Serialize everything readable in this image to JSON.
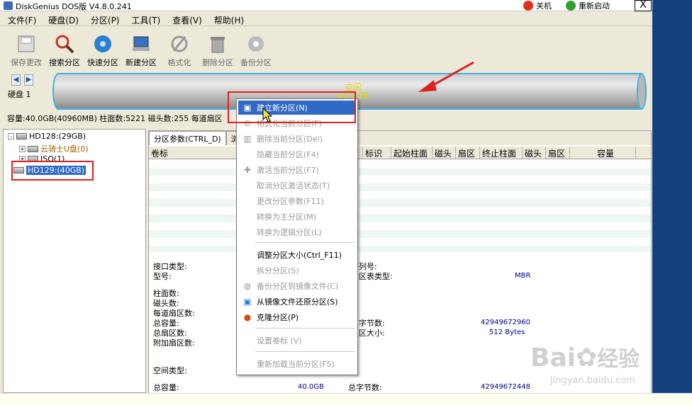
{
  "window": {
    "title": "DiskGenius DOS版 V4.8.0.241",
    "shutdown": "关机",
    "restart": "重新启动",
    "close": "X"
  },
  "menu": [
    "文件(F)",
    "硬盘(D)",
    "分区(P)",
    "工具(T)",
    "查看(V)",
    "帮助(H)"
  ],
  "toolbar": [
    {
      "label": "保存更改",
      "icon": "save-icon",
      "enabled": false
    },
    {
      "label": "搜索分区",
      "icon": "search-icon",
      "enabled": true
    },
    {
      "label": "快速分区",
      "icon": "quick-partition-icon",
      "enabled": true
    },
    {
      "label": "新建分区",
      "icon": "new-partition-icon",
      "enabled": true
    },
    {
      "label": "格式化",
      "icon": "format-icon",
      "enabled": false
    },
    {
      "label": "删除分区",
      "icon": "trash-icon",
      "enabled": false
    },
    {
      "label": "备份分区",
      "icon": "backup-icon",
      "enabled": false
    }
  ],
  "diskbar": {
    "disk_label": "硬盘 1",
    "free_label": "空闲",
    "free_size": "40.0GB",
    "info": "容量:40.0GB(40960MB)  柱面数:5221  磁头数:255  每道扇区"
  },
  "tree": [
    {
      "label": "HD128:(29GB)",
      "level": 0,
      "expander": "-"
    },
    {
      "label": "云骑士U盘(0)",
      "level": 1,
      "expander": "+",
      "color": "#a06000"
    },
    {
      "label": "ISO(1)",
      "level": 1,
      "expander": "+"
    },
    {
      "label": "HD129:(40GB)",
      "level": 0,
      "expander": "",
      "selected": true
    }
  ],
  "tabs": [
    "分区参数(CTRL_D)",
    "浏"
  ],
  "columns": [
    "卷标",
    "标识",
    "起始柱面",
    "磁头",
    "扇区",
    "终止柱面",
    "磁头",
    "扇区",
    "容量"
  ],
  "details": {
    "iface_type": "接口类型:",
    "model": "型号:",
    "serial": "列号:",
    "part_table_type": "区表类型:",
    "part_table_value": "MBR",
    "cylinders": "柱面数:",
    "heads": "磁头数:",
    "sectors_per_track": "每道扇区数:",
    "total_capacity": "总容量:",
    "total_sectors": "总扇区数:",
    "extra_sectors": "附加扇区数:",
    "total_bytes": "字节数:",
    "total_bytes_value": "42949672960",
    "sector_size": "区大小:",
    "sector_size_value": "512 Bytes",
    "space_type": "空间类型:",
    "b_total_capacity": "总容量:",
    "b_capacity_value": "40.0GB",
    "b_total_bytes": "总字节数:",
    "b_total_bytes_value": "42949672448"
  },
  "context_menu": [
    {
      "label": "建立新分区(N)",
      "enabled": true,
      "selected": true,
      "icon": "new-partition-icon"
    },
    {
      "label": "格式化当前分区(F)",
      "enabled": false,
      "icon": "format-icon"
    },
    {
      "label": "删除当前分区(Del)",
      "enabled": false,
      "icon": "trash-icon"
    },
    {
      "label": "隐藏当前分区(F4)",
      "enabled": false
    },
    {
      "label": "激活当前分区(F7)",
      "enabled": false,
      "icon": "activate-icon"
    },
    {
      "label": "取消分区激活状态(T)",
      "enabled": false
    },
    {
      "label": "更改分区参数(F11)",
      "enabled": false
    },
    {
      "label": "转换为主分区(M)",
      "enabled": false
    },
    {
      "label": "转换为逻辑分区(L)",
      "enabled": false
    },
    {
      "label": "调整分区大小(Ctrl_F11)",
      "enabled": true
    },
    {
      "label": "拆分分区(S)",
      "enabled": false
    },
    {
      "label": "备份分区到镜像文件(C)",
      "enabled": false,
      "icon": "backup-icon"
    },
    {
      "label": "从镜像文件还原分区(S)",
      "enabled": true,
      "icon": "restore-icon"
    },
    {
      "label": "克隆分区(P)",
      "enabled": true,
      "icon": "clone-icon"
    },
    {
      "label": "设置卷标 (V)",
      "enabled": false
    },
    {
      "label": "重新加载当前分区(F5)",
      "enabled": false
    }
  ],
  "watermark": {
    "brand": "Bai",
    "brand2": "经验",
    "site": "jingyan.baidu.com"
  },
  "colors": {
    "selection": "#3169c6",
    "highlight_box": "#e02020",
    "accent_border": "#3ab0e8",
    "free_text": "#e4d800"
  }
}
